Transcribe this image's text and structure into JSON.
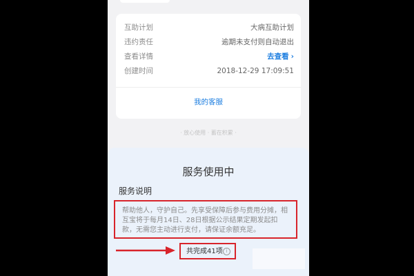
{
  "card": {
    "rows": [
      {
        "label": "互助计划",
        "value": "大病互助计划"
      },
      {
        "label": "违约责任",
        "value": "逾期未支付则自动退出"
      },
      {
        "label": "查看详情",
        "value": "去查看"
      },
      {
        "label": "创建时间",
        "value": "2018-12-29 17:09:51"
      }
    ],
    "service_link": "我的客服"
  },
  "footnote": "· 放心使用 · 蓄在积累 ·",
  "overlay": {
    "title": "服务使用中",
    "section_title": "服务说明",
    "description": "帮助他人，守护自己。先享受保障后参与费用分摊，相互宝将于每月14日、28日根据公示结果定期发起扣款，无需您主动进行支付，请保证余额充足。",
    "completed_count": "共完成41项"
  },
  "icons": {
    "chevron": "chevron-right-icon",
    "info": "info-icon",
    "arrow": "red-arrow-annotation"
  },
  "colors": {
    "link_blue": "#1f7fe0",
    "annotation_red": "#d8232a"
  }
}
